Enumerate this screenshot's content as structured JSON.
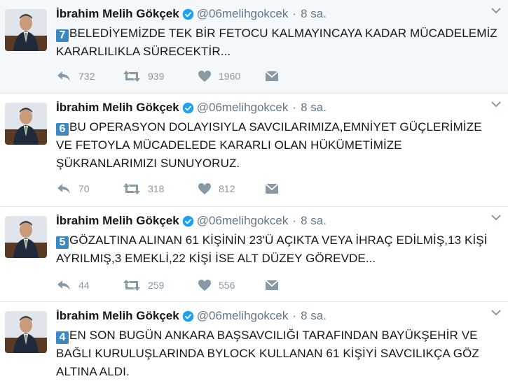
{
  "tweets": [
    {
      "name": "İbrahim Melih Gökçek",
      "handle": "@06melihgokcek",
      "separator": "·",
      "time": "8 sa.",
      "number": "7",
      "text": "BELEDİYEMİZDE TEK BİR FETOCU KALMAYINCAYA KADAR MÜCADELEMİZ KARARLILIKLA SÜRECEKTİR...",
      "replies": "732",
      "retweets": "939",
      "likes": "1960"
    },
    {
      "name": "İbrahim Melih Gökçek",
      "handle": "@06melihgokcek",
      "separator": "·",
      "time": "8 sa.",
      "number": "6",
      "text": "BU OPERASYON DOLAYISIYLA SAVCILARIMIZA,EMNİYET GÜÇLERİMİZE VE FETOYLA MÜCADELEDE KARARLI OLAN HÜKÜMETİMİZE ŞÜKRANLARIMIZI SUNUYORUZ.",
      "replies": "70",
      "retweets": "318",
      "likes": "812"
    },
    {
      "name": "İbrahim Melih Gökçek",
      "handle": "@06melihgokcek",
      "separator": "·",
      "time": "8 sa.",
      "number": "5",
      "text": "GÖZALTINA ALINAN 61 KİŞİNİN 23'Ü AÇIKTA VEYA İHRAÇ EDİLMİŞ,13 KİŞİ AYRILMIŞ,3 EMEKLİ,22 KİŞİ İSE ALT DÜZEY GÖREVDE...",
      "replies": "44",
      "retweets": "259",
      "likes": "556"
    },
    {
      "name": "İbrahim Melih Gökçek",
      "handle": "@06melihgokcek",
      "separator": "·",
      "time": "8 sa.",
      "number": "4",
      "text": "EN SON BUGÜN ANKARA BAŞSAVCILIĞI TARAFINDAN BAYÜKŞEHİR VE BAĞLI KURULUŞLARINDA BYLOCK KULLANAN 61 KİŞİYİ SAVCILIKÇA GÖZ ALTINA ALDI.",
      "replies": "",
      "retweets": "",
      "likes": ""
    }
  ],
  "colors": {
    "verified": "#1da1f2",
    "number_badge": "#3b88c3",
    "action_icons": "#8899a6",
    "handle": "#657786"
  },
  "icons": [
    "verified-badge-icon",
    "caret-down-icon",
    "reply-icon",
    "retweet-icon",
    "heart-icon",
    "message-icon"
  ]
}
